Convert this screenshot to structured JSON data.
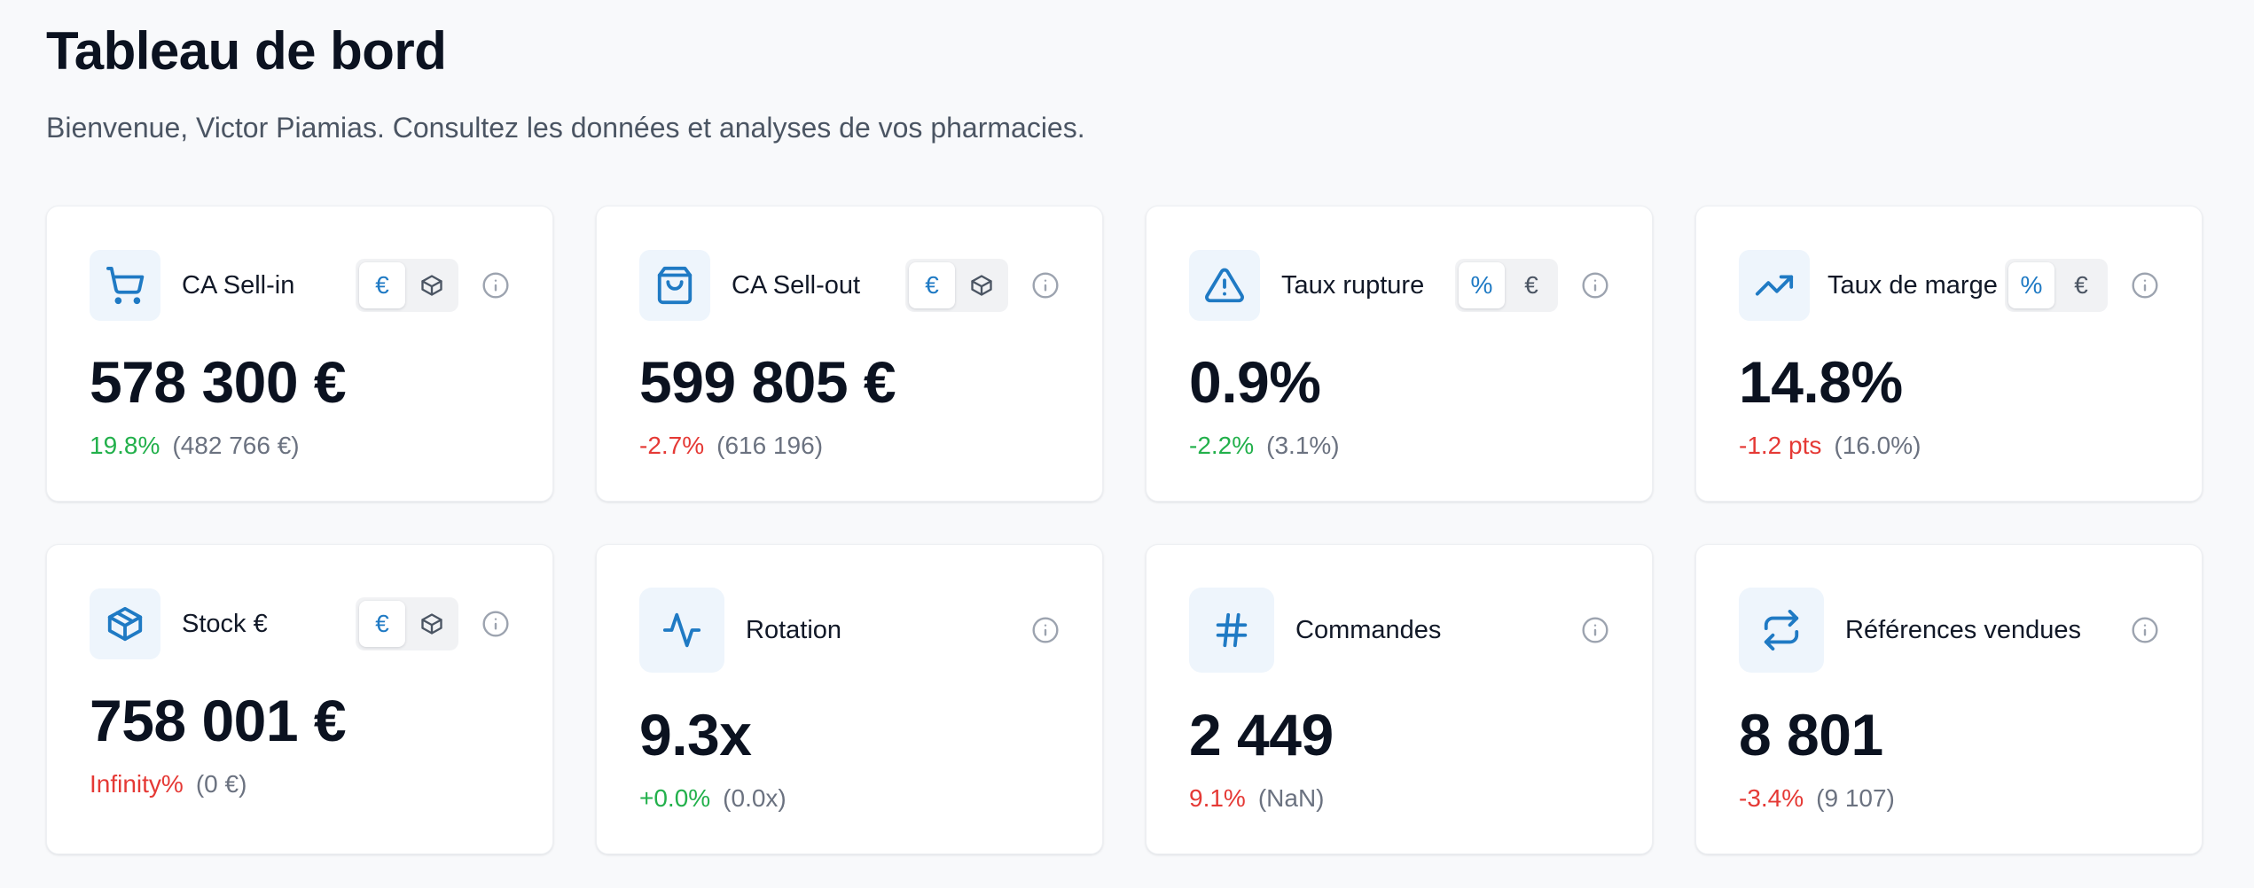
{
  "header": {
    "title": "Tableau de bord",
    "subtitle": "Bienvenue, Victor Piamias. Consultez les données et analyses de vos pharmacies."
  },
  "colors": {
    "accent": "#1f7ac4",
    "positive": "#22b04b",
    "negative": "#e53935"
  },
  "cards": [
    {
      "label": "CA Sell-in",
      "icon": "shopping-cart-icon",
      "value": "578 300 €",
      "delta": "19.8%",
      "delta_sign": "positive",
      "previous": "(482 766 €)",
      "toggle": [
        "€",
        "box-icon"
      ],
      "toggle_active": 0
    },
    {
      "label": "CA Sell-out",
      "icon": "shopping-bag-icon",
      "value": "599 805 €",
      "delta": "-2.7%",
      "delta_sign": "negative",
      "previous": "(616 196)",
      "toggle": [
        "€",
        "box-icon"
      ],
      "toggle_active": 0
    },
    {
      "label": "Taux rupture",
      "icon": "alert-triangle-icon",
      "value": "0.9%",
      "delta": "-2.2%",
      "delta_sign": "positive",
      "previous": "(3.1%)",
      "toggle": [
        "%",
        "€"
      ],
      "toggle_active": 0
    },
    {
      "label": "Taux de marge",
      "icon": "trending-up-icon",
      "value": "14.8%",
      "delta": "-1.2 pts",
      "delta_sign": "negative",
      "previous": "(16.0%)",
      "toggle": [
        "%",
        "€"
      ],
      "toggle_active": 0
    },
    {
      "label": "Stock €",
      "icon": "package-icon",
      "value": "758 001 €",
      "delta": "Infinity%",
      "delta_sign": "negative",
      "previous": "(0 €)",
      "toggle": [
        "€",
        "box-icon"
      ],
      "toggle_active": 0
    },
    {
      "label": "Rotation",
      "icon": "activity-icon",
      "value": "9.3x",
      "delta": "+0.0%",
      "delta_sign": "positive",
      "previous": "(0.0x)"
    },
    {
      "label": "Commandes",
      "icon": "hash-icon",
      "value": "2 449",
      "delta": "9.1%",
      "delta_sign": "negative",
      "previous": "(NaN)"
    },
    {
      "label": "Références vendues",
      "icon": "repeat-icon",
      "value": "8 801",
      "delta": "-3.4%",
      "delta_sign": "negative",
      "previous": "(9 107)"
    }
  ]
}
